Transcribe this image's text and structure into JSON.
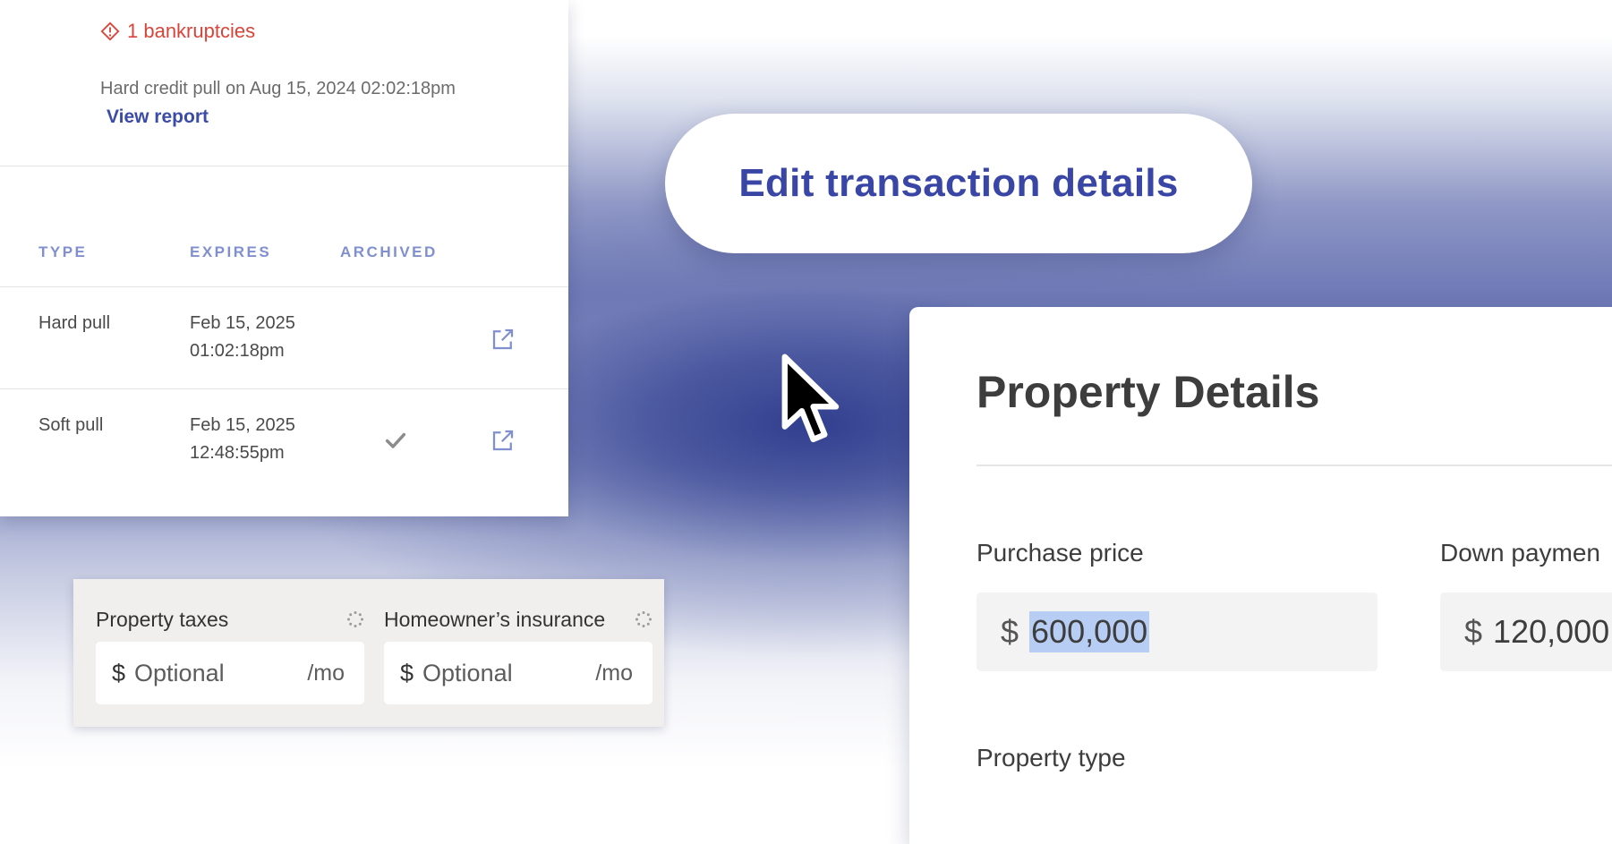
{
  "credit": {
    "bankruptcies": "1 bankruptcies",
    "pull_info": "Hard credit pull on Aug 15, 2024 02:02:18pm",
    "view_report": "View report",
    "table": {
      "headers": [
        "TYPE",
        "EXPIRES",
        "ARCHIVED"
      ],
      "rows": [
        {
          "type": "Hard pull",
          "date": "Feb 15, 2025",
          "time": "01:02:18pm",
          "archived": false
        },
        {
          "type": "Soft pull",
          "date": "Feb 15, 2025",
          "time": "12:48:55pm",
          "archived": true
        }
      ]
    }
  },
  "edit_button": "Edit transaction details",
  "property": {
    "title": "Property Details",
    "purchase_price": {
      "label": "Purchase price",
      "currency": "$",
      "value": "600,000"
    },
    "down_payment": {
      "label": "Down paymen",
      "currency": "$",
      "value": "120,000"
    },
    "property_type_label": "Property type"
  },
  "taxes": {
    "property_taxes": {
      "label": "Property taxes",
      "currency": "$",
      "placeholder": "Optional",
      "unit": "/mo"
    },
    "insurance": {
      "label": "Homeowner’s insurance",
      "currency": "$",
      "placeholder": "Optional",
      "unit": "/mo"
    }
  },
  "colors": {
    "accent": "#3946a6",
    "alert": "#d9443a",
    "header": "#7f8fd0"
  }
}
